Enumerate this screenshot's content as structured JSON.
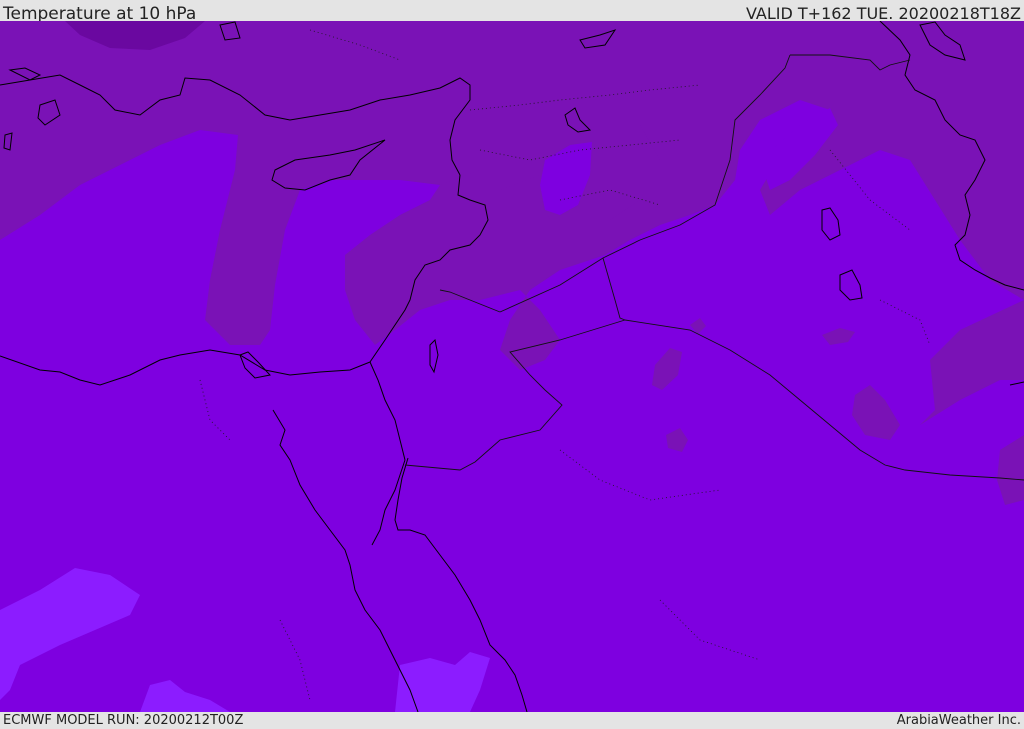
{
  "header": {
    "title": "Temperature at 10 hPa",
    "valid": "VALID T+162 TUE. 20200218T18Z"
  },
  "footer": {
    "model_run": "ECMWF MODEL RUN: 20200212T00Z",
    "credit": "ArabiaWeather Inc."
  },
  "map": {
    "colors": {
      "base_field": "#7e00e0",
      "warmer_band": "#7a12b6",
      "warmest_patch": "#6a08a0",
      "cold_patch": "#8c1cff",
      "coastline": "#000000",
      "border": "#111111"
    }
  }
}
